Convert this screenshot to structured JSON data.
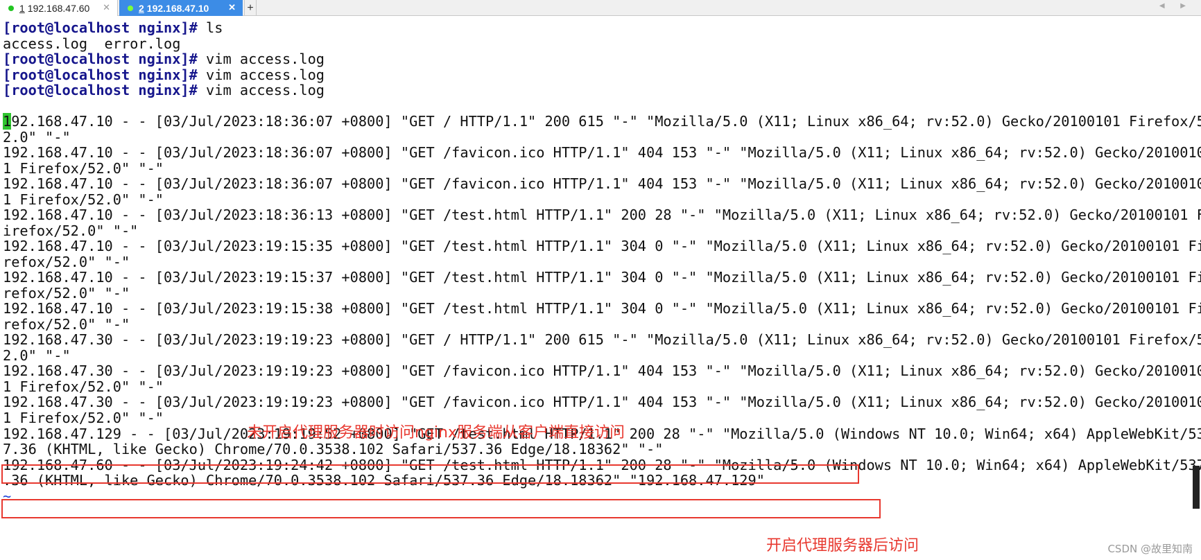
{
  "tabs": [
    {
      "number": "1",
      "title": "192.168.47.60",
      "close": "✕"
    },
    {
      "number": "2",
      "title": "192.168.47.10",
      "close": "✕"
    }
  ],
  "new_tab_label": "+",
  "nav_arrows": "◀ ▶",
  "terminal": {
    "prompt": "[root@localhost nginx]#",
    "commands": [
      " ls",
      " vim access.log",
      " vim access.log",
      " vim access.log"
    ],
    "ls_output": "access.log  error.log",
    "cursor_char": "1",
    "first_line_rest": "92.168.47.10 - - [03/Jul/2023:18:36:07 +0800] \"GET / HTTP/1.1\" 200 615 \"-\" \"Mozilla/5.0 (X11; Linux x86_64; rv:52.0) Gecko/20100101 Firefox/5",
    "log_lines": [
      "2.0\" \"-\"",
      "192.168.47.10 - - [03/Jul/2023:18:36:07 +0800] \"GET /favicon.ico HTTP/1.1\" 404 153 \"-\" \"Mozilla/5.0 (X11; Linux x86_64; rv:52.0) Gecko/2010010",
      "1 Firefox/52.0\" \"-\"",
      "192.168.47.10 - - [03/Jul/2023:18:36:07 +0800] \"GET /favicon.ico HTTP/1.1\" 404 153 \"-\" \"Mozilla/5.0 (X11; Linux x86_64; rv:52.0) Gecko/2010010",
      "1 Firefox/52.0\" \"-\"",
      "192.168.47.10 - - [03/Jul/2023:18:36:13 +0800] \"GET /test.html HTTP/1.1\" 200 28 \"-\" \"Mozilla/5.0 (X11; Linux x86_64; rv:52.0) Gecko/20100101 F",
      "irefox/52.0\" \"-\"",
      "192.168.47.10 - - [03/Jul/2023:19:15:35 +0800] \"GET /test.html HTTP/1.1\" 304 0 \"-\" \"Mozilla/5.0 (X11; Linux x86_64; rv:52.0) Gecko/20100101 Fi",
      "refox/52.0\" \"-\"",
      "192.168.47.10 - - [03/Jul/2023:19:15:37 +0800] \"GET /test.html HTTP/1.1\" 304 0 \"-\" \"Mozilla/5.0 (X11; Linux x86_64; rv:52.0) Gecko/20100101 Fi",
      "refox/52.0\" \"-\"",
      "192.168.47.10 - - [03/Jul/2023:19:15:38 +0800] \"GET /test.html HTTP/1.1\" 304 0 \"-\" \"Mozilla/5.0 (X11; Linux x86_64; rv:52.0) Gecko/20100101 Fi",
      "refox/52.0\" \"-\"",
      "192.168.47.30 - - [03/Jul/2023:19:19:23 +0800] \"GET / HTTP/1.1\" 200 615 \"-\" \"Mozilla/5.0 (X11; Linux x86_64; rv:52.0) Gecko/20100101 Firefox/5",
      "2.0\" \"-\"",
      "192.168.47.30 - - [03/Jul/2023:19:19:23 +0800] \"GET /favicon.ico HTTP/1.1\" 404 153 \"-\" \"Mozilla/5.0 (X11; Linux x86_64; rv:52.0) Gecko/2010010",
      "1 Firefox/52.0\" \"-\"",
      "192.168.47.30 - - [03/Jul/2023:19:19:23 +0800] \"GET /favicon.ico HTTP/1.1\" 404 153 \"-\" \"Mozilla/5.0 (X11; Linux x86_64; rv:52.0) Gecko/2010010",
      "1 Firefox/52.0\" \"-\"",
      "192.168.47.129 - - [03/Jul/2023:19:19:52 +0800] \"GET /test.html HTTP/1.1\" 200 28 \"-\" \"Mozilla/5.0 (Windows NT 10.0; Win64; x64) AppleWebKit/53",
      "7.36 (KHTML, like Gecko) Chrome/70.0.3538.102 Safari/537.36 Edge/18.18362\" \"-\"",
      "192.168.47.60 - - [03/Jul/2023:19:24:42 +0800] \"GET /test.html HTTP/1.1\" 200 28 \"-\" \"Mozilla/5.0 (Windows NT 10.0; Win64; x64) AppleWebKit/537",
      ".36 (KHTML, like Gecko) Chrome/70.0.3538.102 Safari/537.36 Edge/18.18362\" \"192.168.47.129\""
    ],
    "tilde": "~"
  },
  "annotations": {
    "without_proxy": "未开启代理服务器时访问nginx服务端从客户端直接访问",
    "with_proxy": "开启代理服务器后访问"
  },
  "watermark": "CSDN @故里知南",
  "colors": {
    "annotation": "#e8382f",
    "prompt": "#16168c",
    "active_tab": "#3c8ce6",
    "cursor": "#2fc52f"
  }
}
